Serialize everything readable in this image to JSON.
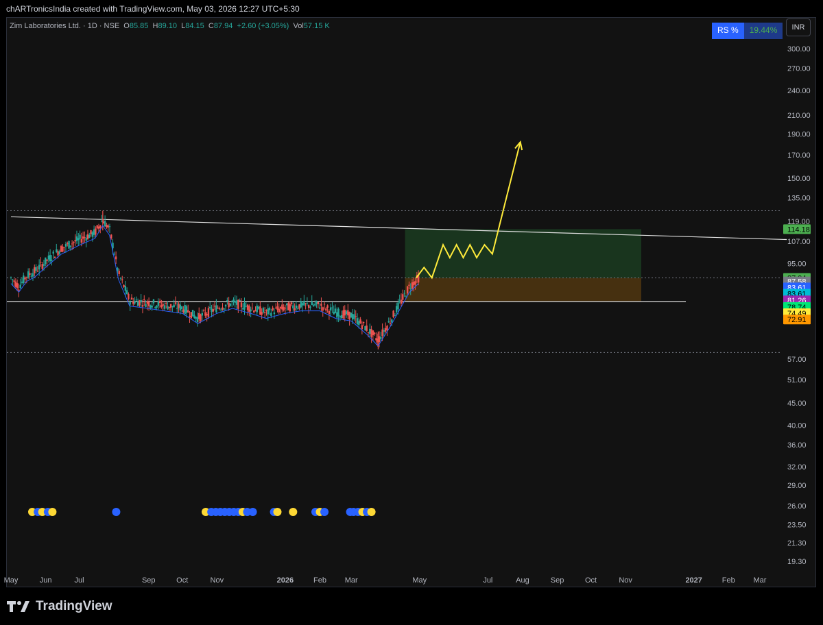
{
  "header": {
    "attribution": "chARTronicsIndia created with TradingView.com, May 03, 2026 12:27 UTC+5:30"
  },
  "legend": {
    "symbol": "Zim Laboratories Ltd. · 1D · NSE",
    "o_label": "O",
    "o_value": "85.85",
    "h_label": "H",
    "h_value": "89.10",
    "l_label": "L",
    "l_value": "84.15",
    "c_label": "C",
    "c_value": "87.94",
    "change": "+2.60 (+3.05%)",
    "vol_label": "Vol",
    "vol_value": "57.15 K"
  },
  "rs": {
    "label": "RS %",
    "value": "19.44%"
  },
  "currency": "INR",
  "footer": {
    "brand": "TradingView"
  },
  "colors": {
    "up": "#26a69a",
    "down": "#ef5350",
    "prediction": "#ffeb3b",
    "target_zone": "#1b3a20",
    "stop_zone": "#4a3311"
  },
  "chart_data": {
    "type": "candlestick",
    "symbol": "Zim Laboratories Ltd.",
    "timeframe": "1D",
    "exchange": "NSE",
    "y_scale": "log",
    "ylim": [
      18,
      320
    ],
    "y_ticks": [
      300.0,
      270.0,
      240.0,
      210.0,
      190.0,
      170.0,
      150.0,
      135.0,
      119.0,
      107.0,
      95.0,
      57.0,
      51.0,
      45.0,
      40.0,
      36.0,
      32.0,
      29.0,
      26.0,
      23.5,
      21.3,
      19.3
    ],
    "x_ticks": [
      {
        "label": "May",
        "date": "2025-05-01",
        "bold": false
      },
      {
        "label": "Jun",
        "date": "2025-06-01",
        "bold": false
      },
      {
        "label": "Jul",
        "date": "2025-07-01",
        "bold": false
      },
      {
        "label": "Sep",
        "date": "2025-09-01",
        "bold": false
      },
      {
        "label": "Oct",
        "date": "2025-10-01",
        "bold": false
      },
      {
        "label": "Nov",
        "date": "2025-11-01",
        "bold": false
      },
      {
        "label": "2026",
        "date": "2026-01-01",
        "bold": true
      },
      {
        "label": "Feb",
        "date": "2026-02-01",
        "bold": false
      },
      {
        "label": "Mar",
        "date": "2026-03-01",
        "bold": false
      },
      {
        "label": "May",
        "date": "2026-05-01",
        "bold": false
      },
      {
        "label": "Jul",
        "date": "2026-07-01",
        "bold": false
      },
      {
        "label": "Aug",
        "date": "2026-08-01",
        "bold": false
      },
      {
        "label": "Sep",
        "date": "2026-09-01",
        "bold": false
      },
      {
        "label": "Oct",
        "date": "2026-10-01",
        "bold": false
      },
      {
        "label": "Nov",
        "date": "2026-11-01",
        "bold": false
      },
      {
        "label": "2027",
        "date": "2027-01-01",
        "bold": true
      },
      {
        "label": "Feb",
        "date": "2027-02-01",
        "bold": false
      },
      {
        "label": "Mar",
        "date": "2027-03-01",
        "bold": false
      }
    ],
    "price_path": [
      [
        "2025-05-01",
        88
      ],
      [
        "2025-05-08",
        84
      ],
      [
        "2025-05-15",
        89
      ],
      [
        "2025-05-22",
        91
      ],
      [
        "2025-06-01",
        96
      ],
      [
        "2025-06-15",
        103
      ],
      [
        "2025-07-01",
        108
      ],
      [
        "2025-07-15",
        112
      ],
      [
        "2025-07-22",
        120
      ],
      [
        "2025-07-28",
        114
      ],
      [
        "2025-08-05",
        90
      ],
      [
        "2025-08-15",
        78
      ],
      [
        "2025-09-01",
        77
      ],
      [
        "2025-09-15",
        76
      ],
      [
        "2025-10-01",
        75
      ],
      [
        "2025-10-15",
        71
      ],
      [
        "2025-11-01",
        75
      ],
      [
        "2025-11-15",
        77
      ],
      [
        "2025-12-01",
        75
      ],
      [
        "2025-12-15",
        73
      ],
      [
        "2026-01-01",
        75
      ],
      [
        "2026-01-15",
        76
      ],
      [
        "2026-02-01",
        76
      ],
      [
        "2026-02-15",
        73
      ],
      [
        "2026-03-01",
        72
      ],
      [
        "2026-03-15",
        67
      ],
      [
        "2026-03-25",
        63
      ],
      [
        "2026-04-05",
        70
      ],
      [
        "2026-04-15",
        78
      ],
      [
        "2026-04-22",
        84
      ],
      [
        "2026-04-30",
        87.94
      ]
    ],
    "wick_high": [
      "2025-07-22",
      126
    ],
    "wick_low": [
      "2026-03-25",
      60
    ],
    "price_labels": [
      {
        "value": "114.18",
        "price": 114.18,
        "bg": "#4caf50",
        "fg": "#000"
      },
      {
        "value": "87.94",
        "price": 87.94,
        "bg": "#4caf50",
        "fg": "#000"
      },
      {
        "value": "87.58",
        "price": 86.3,
        "bg": "#787b86",
        "fg": "#fff"
      },
      {
        "value": "83.61",
        "price": 83.61,
        "bg": "#2962ff",
        "fg": "#fff"
      },
      {
        "value": "83.61",
        "price": 80.8,
        "bg": "#00bcd4",
        "fg": "#000"
      },
      {
        "value": "81.26",
        "price": 78.0,
        "bg": "#9c27b0",
        "fg": "#fff"
      },
      {
        "value": "78.74",
        "price": 75.3,
        "bg": "#00e676",
        "fg": "#000"
      },
      {
        "value": "74.49",
        "price": 72.8,
        "bg": "#ffeb3b",
        "fg": "#000"
      },
      {
        "value": "72.91",
        "price": 70.4,
        "bg": "#ff9800",
        "fg": "#000"
      }
    ],
    "levels": {
      "upper_dotted": 126,
      "entry": 87.94,
      "support": 77.5,
      "lower_dotted": 59
    },
    "resistance_trendline": [
      [
        "2025-05-01",
        122
      ],
      [
        "2027-03-25",
        108
      ]
    ],
    "target_zone": {
      "from": "2026-04-18",
      "to": "2026-11-15",
      "low": 87.94,
      "high": 114.18
    },
    "stop_zone": {
      "from": "2026-04-18",
      "to": "2026-11-15",
      "low": 77.5,
      "high": 87.94
    },
    "projection": [
      [
        "2026-04-28",
        88
      ],
      [
        "2026-05-05",
        93
      ],
      [
        "2026-05-12",
        88
      ],
      [
        "2026-05-22",
        105
      ],
      [
        "2026-05-28",
        98
      ],
      [
        "2026-06-03",
        105
      ],
      [
        "2026-06-09",
        98
      ],
      [
        "2026-06-15",
        105
      ],
      [
        "2026-06-21",
        98
      ],
      [
        "2026-06-28",
        105
      ],
      [
        "2026-07-05",
        100
      ],
      [
        "2026-07-30",
        182
      ]
    ],
    "signal_dots": [
      [
        "2025-05-20",
        "yellow"
      ],
      [
        "2025-05-25",
        "blue"
      ],
      [
        "2025-05-29",
        "yellow"
      ],
      [
        "2025-06-03",
        "blue"
      ],
      [
        "2025-06-07",
        "yellow"
      ],
      [
        "2025-08-03",
        "blue"
      ],
      [
        "2025-10-22",
        "yellow"
      ],
      [
        "2025-10-27",
        "blue"
      ],
      [
        "2025-10-31",
        "blue"
      ],
      [
        "2025-11-04",
        "blue"
      ],
      [
        "2025-11-08",
        "blue"
      ],
      [
        "2025-11-12",
        "blue"
      ],
      [
        "2025-11-16",
        "blue"
      ],
      [
        "2025-11-20",
        "blue"
      ],
      [
        "2025-11-24",
        "yellow"
      ],
      [
        "2025-11-28",
        "blue"
      ],
      [
        "2025-12-03",
        "blue"
      ],
      [
        "2025-12-22",
        "blue"
      ],
      [
        "2025-12-25",
        "yellow"
      ],
      [
        "2026-01-08",
        "yellow"
      ],
      [
        "2026-01-28",
        "blue"
      ],
      [
        "2026-02-01",
        "yellow"
      ],
      [
        "2026-02-05",
        "blue"
      ],
      [
        "2026-02-28",
        "blue"
      ],
      [
        "2026-03-03",
        "blue"
      ],
      [
        "2026-03-07",
        "blue"
      ],
      [
        "2026-03-11",
        "yellow"
      ],
      [
        "2026-03-15",
        "blue"
      ],
      [
        "2026-03-19",
        "yellow"
      ]
    ]
  }
}
